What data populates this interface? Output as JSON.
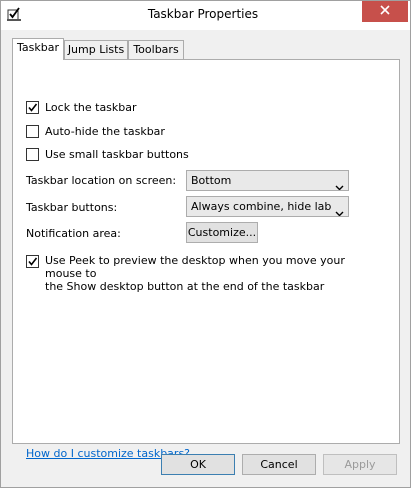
{
  "window": {
    "title": "Taskbar Properties"
  },
  "tabs": [
    {
      "label": "Taskbar",
      "active": true
    },
    {
      "label": "Jump Lists",
      "active": false
    },
    {
      "label": "Toolbars",
      "active": false
    }
  ],
  "options": {
    "lock_taskbar": {
      "label": "Lock the taskbar",
      "checked": true
    },
    "auto_hide": {
      "label": "Auto-hide the taskbar",
      "checked": false
    },
    "small_buttons": {
      "label": "Use small taskbar buttons",
      "checked": false
    },
    "location": {
      "label": "Taskbar location on screen:",
      "value": "Bottom"
    },
    "buttons": {
      "label": "Taskbar buttons:",
      "value": "Always combine, hide labels"
    },
    "notification": {
      "label": "Notification area:",
      "button_label": "Customize..."
    },
    "peek": {
      "label_line1": "Use Peek to preview the desktop when you move your mouse to",
      "label_line2": "the Show desktop button at the end of the taskbar",
      "checked": true
    }
  },
  "help_link": "How do I customize taskbars?",
  "footer": {
    "ok_label": "OK",
    "cancel_label": "Cancel",
    "apply_label": "Apply"
  },
  "colors": {
    "close_button": "#c7504b",
    "link": "#0066cc"
  }
}
